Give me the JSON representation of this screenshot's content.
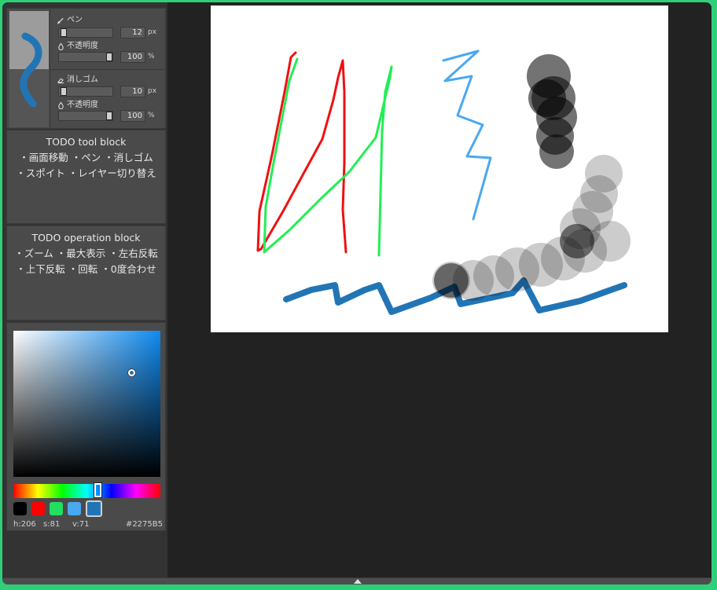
{
  "brush_panel": {
    "pen": {
      "label": "ペン",
      "size_value": "12",
      "size_unit": "px",
      "opacity_label": "不透明度",
      "opacity_value": "100",
      "opacity_unit": "%"
    },
    "eraser": {
      "label": "消しゴム",
      "size_value": "10",
      "size_unit": "px",
      "opacity_label": "不透明度",
      "opacity_value": "100",
      "opacity_unit": "%"
    }
  },
  "tool_block": {
    "title": "TODO tool block",
    "line1": "・画面移動 ・ペン ・消しゴム",
    "line2": "・スポイト ・レイヤー切り替え"
  },
  "operation_block": {
    "title": "TODO operation block",
    "line1": "・ズーム ・最大表示 ・左右反転",
    "line2": "・上下反転 ・回転 ・0度合わせ"
  },
  "color_picker": {
    "h_label": "h:206",
    "s_label": "s:81",
    "v_label": "v:71",
    "hex": "#2275B5",
    "hue_fraction": 0.572,
    "saturation": 0.81,
    "value": 0.71,
    "swatches": [
      "#000000",
      "#ff0000",
      "#20e060",
      "#4aa8f0",
      "#2275B5"
    ]
  },
  "colors": {
    "background_frame": "#2ecf78",
    "app_bg": "#222222",
    "panel_bg": "#4a4a4a",
    "canvas_bg": "#ffffff"
  },
  "icons": {
    "pen": "pen-icon",
    "eraser": "eraser-icon",
    "opacity": "droplet-icon",
    "expand": "chevron-up-icon"
  }
}
